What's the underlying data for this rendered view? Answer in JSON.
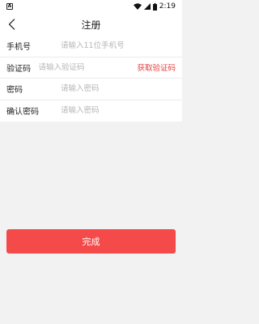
{
  "status_bar": {
    "time": "2:19",
    "notification_icon": "app-a-icon",
    "icons": [
      "wifi-icon",
      "signal-icon",
      "battery-icon"
    ]
  },
  "header": {
    "title": "注册",
    "back_icon": "chevron-left-icon"
  },
  "form": {
    "fields": [
      {
        "label": "手机号",
        "placeholder": "请输入11位手机号",
        "value": ""
      },
      {
        "label": "验证码",
        "placeholder": "请输入验证码",
        "value": ""
      },
      {
        "label": "密码",
        "placeholder": "请输入密码",
        "value": ""
      },
      {
        "label": "确认密码",
        "placeholder": "请输入密码",
        "value": ""
      }
    ],
    "get_code_label": "获取验证码"
  },
  "submit": {
    "label": "完成"
  },
  "colors": {
    "accent": "#f44a4a",
    "link": "#e94040",
    "background": "#f2f2f2",
    "placeholder": "#b5b5b5"
  }
}
